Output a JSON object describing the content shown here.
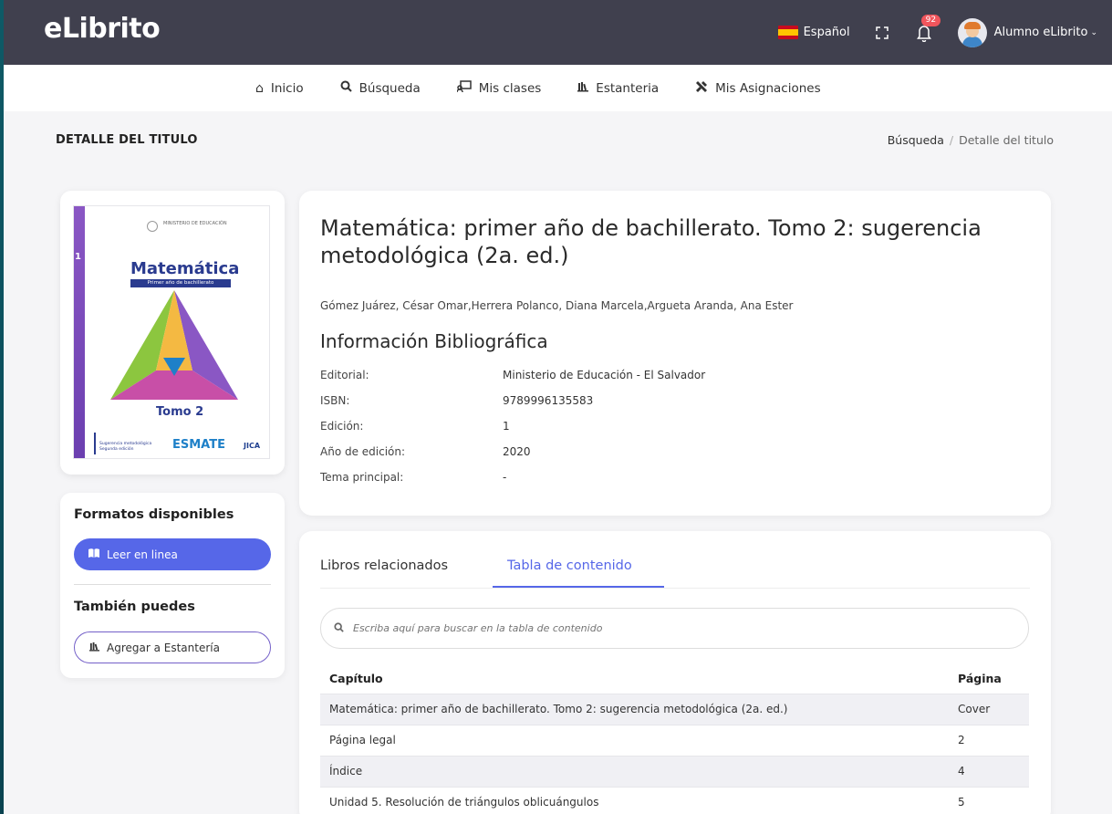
{
  "header": {
    "logo": "eLibrito",
    "language": "Español",
    "notifications_count": "92",
    "user_name": "Alumno eLibrito"
  },
  "nav": {
    "items": [
      {
        "label": "Inicio",
        "icon": "home-icon"
      },
      {
        "label": "Búsqueda",
        "icon": "search-icon"
      },
      {
        "label": "Mis clases",
        "icon": "classes-icon"
      },
      {
        "label": "Estanteria",
        "icon": "bookshelf-icon"
      },
      {
        "label": "Mis Asignaciones",
        "icon": "tools-icon"
      }
    ]
  },
  "page": {
    "title": "DETALLE DEL TITULO",
    "breadcrumb": [
      "Búsqueda",
      "Detalle del titulo"
    ]
  },
  "cover": {
    "title": "Matemática",
    "subtitle": "Primer año de bachillerato",
    "volume": "Tomo 2",
    "spine_number": "1",
    "footer_text": "Sugerencia metodológica Segunda edición",
    "brand": "ESMATE",
    "partner": "JICA",
    "ministry": "MINISTERIO DE EDUCACIÓN"
  },
  "formats": {
    "heading": "Formatos disponibles",
    "read_online": "Leer en linea",
    "also_heading": "También puedes",
    "add_shelf": "Agregar a Estantería"
  },
  "book": {
    "title": "Matemática: primer año de bachillerato. Tomo 2: sugerencia metodológica (2a. ed.)",
    "authors": "Gómez Juárez, César Omar,Herrera Polanco, Diana Marcela,Argueta Aranda, Ana Ester",
    "bib_heading": "Información Bibliográfica",
    "bib": [
      {
        "k": "Editorial:",
        "v": "Ministerio de Educación - El Salvador"
      },
      {
        "k": "ISBN:",
        "v": "9789996135583"
      },
      {
        "k": "Edición:",
        "v": "1"
      },
      {
        "k": "Año de edición:",
        "v": "2020"
      },
      {
        "k": "Tema principal:",
        "v": "-"
      }
    ]
  },
  "toc": {
    "tabs": [
      "Libros relacionados",
      "Tabla de contenido"
    ],
    "active_tab": 1,
    "search_placeholder": "Escriba aquí para buscar en la tabla de contenido",
    "col_chapter": "Capítulo",
    "col_page": "Página",
    "rows": [
      {
        "chapter": "Matemática: primer año de bachillerato. Tomo 2: sugerencia metodológica (2a. ed.)",
        "page": "Cover"
      },
      {
        "chapter": "Página legal",
        "page": "2"
      },
      {
        "chapter": "Índice",
        "page": "4"
      },
      {
        "chapter": "Unidad 5. Resolución de triángulos oblicuángulos",
        "page": "5"
      }
    ]
  },
  "colors": {
    "header_bg": "#40404e",
    "accent": "#5667e8",
    "outline_button": "#7460c8",
    "badge": "#f0555c"
  }
}
